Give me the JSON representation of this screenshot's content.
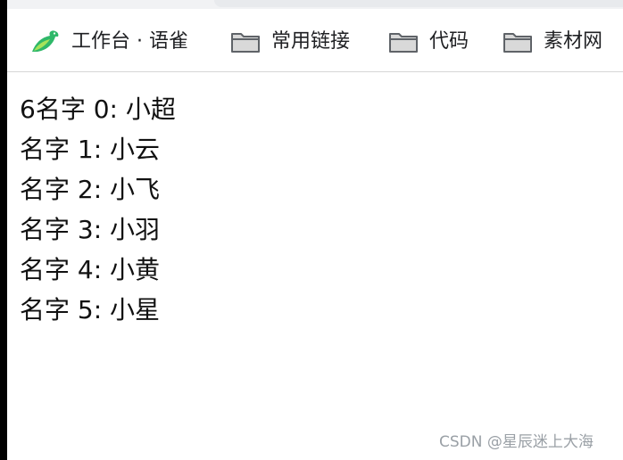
{
  "bookmarks_bar": {
    "items": [
      {
        "label": "工作台 · 语雀",
        "icon": "yuque-bird-icon"
      },
      {
        "label": "常用链接",
        "icon": "folder-icon"
      },
      {
        "label": "代码",
        "icon": "folder-icon"
      },
      {
        "label": "素材网",
        "icon": "folder-icon"
      }
    ]
  },
  "content": {
    "lines": [
      "6名字 0: 小超",
      "名字 1: 小云",
      "名字 2: 小飞",
      "名字 3: 小羽",
      "名字 4: 小黄",
      "名字 5: 小星"
    ]
  },
  "watermark": {
    "text": "CSDN @星辰迷上大海"
  },
  "colors": {
    "folder_fill": "#c7c7c7",
    "folder_stroke": "#5f6368",
    "yuque_green": "#2fb869",
    "text": "#111111"
  }
}
